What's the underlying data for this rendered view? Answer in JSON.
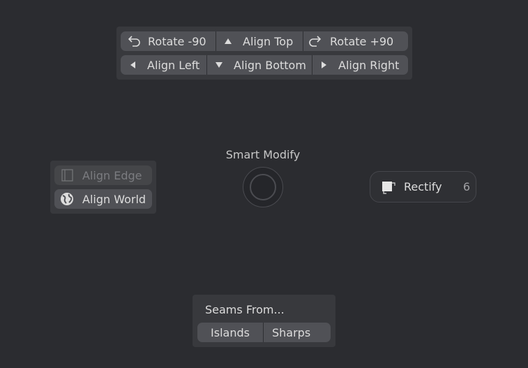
{
  "top_menu": {
    "row1": [
      {
        "label": "Rotate -90",
        "icon": "rotate-ccw-icon"
      },
      {
        "label": "Align Top",
        "icon": "triangle-up-icon"
      },
      {
        "label": "Rotate +90",
        "icon": "rotate-cw-icon"
      }
    ],
    "row2": [
      {
        "label": "Align Left",
        "icon": "triangle-left-icon"
      },
      {
        "label": "Align Bottom",
        "icon": "triangle-down-icon"
      },
      {
        "label": "Align Right",
        "icon": "triangle-right-icon"
      }
    ]
  },
  "center": {
    "title": "Smart Modify"
  },
  "left_menu": {
    "items": [
      {
        "label": "Align Edge",
        "icon": "align-edge-icon",
        "enabled": false
      },
      {
        "label": "Align World",
        "icon": "globe-icon",
        "enabled": true
      }
    ]
  },
  "right_item": {
    "label": "Rectify",
    "icon": "rectify-icon",
    "shortcut": "6"
  },
  "bottom_menu": {
    "title": "Seams From...",
    "buttons": [
      {
        "label": "Islands"
      },
      {
        "label": "Sharps"
      }
    ]
  },
  "colors": {
    "background": "#2b2c30",
    "panel": "#38393d",
    "button": "#505156",
    "text": "#dcdcdc"
  }
}
